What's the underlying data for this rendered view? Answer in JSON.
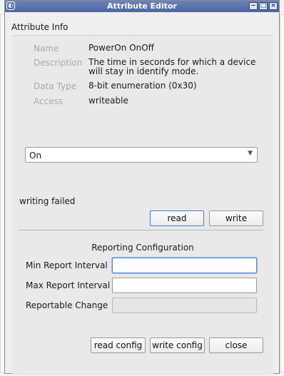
{
  "window": {
    "title": "Attribute Editor",
    "app_icon": "app-logo-icon",
    "controls": [
      "minimize-icon",
      "maximize-icon",
      "close-icon"
    ]
  },
  "attribute_info": {
    "section_title": "Attribute Info",
    "rows": [
      {
        "key": "Name",
        "value": "PowerOn OnOff"
      },
      {
        "key": "Description",
        "value": "The time in seconds for which a device will stay in identify mode."
      },
      {
        "key": "Data Type",
        "value": "8-bit enumeration (0x30)"
      },
      {
        "key": "Access",
        "value": "writeable"
      }
    ]
  },
  "value_combo": {
    "selected": "On",
    "icon": "chevron-down-icon"
  },
  "status_text": "writing failed",
  "buttons": {
    "read": "read",
    "write": "write",
    "read_config": "read config",
    "write_config": "write config",
    "close": "close"
  },
  "reporting": {
    "title": "Reporting Configuration",
    "fields": [
      {
        "label": "Min Report Interval",
        "value": "",
        "state": "focused"
      },
      {
        "label": "Max Report Interval",
        "value": "",
        "state": "normal"
      },
      {
        "label": "Reportable Change",
        "value": "",
        "state": "disabled"
      }
    ]
  },
  "colors": {
    "titlebar": "#5572ad",
    "window_bg": "#efefef",
    "focus_border": "#4a86d8"
  }
}
